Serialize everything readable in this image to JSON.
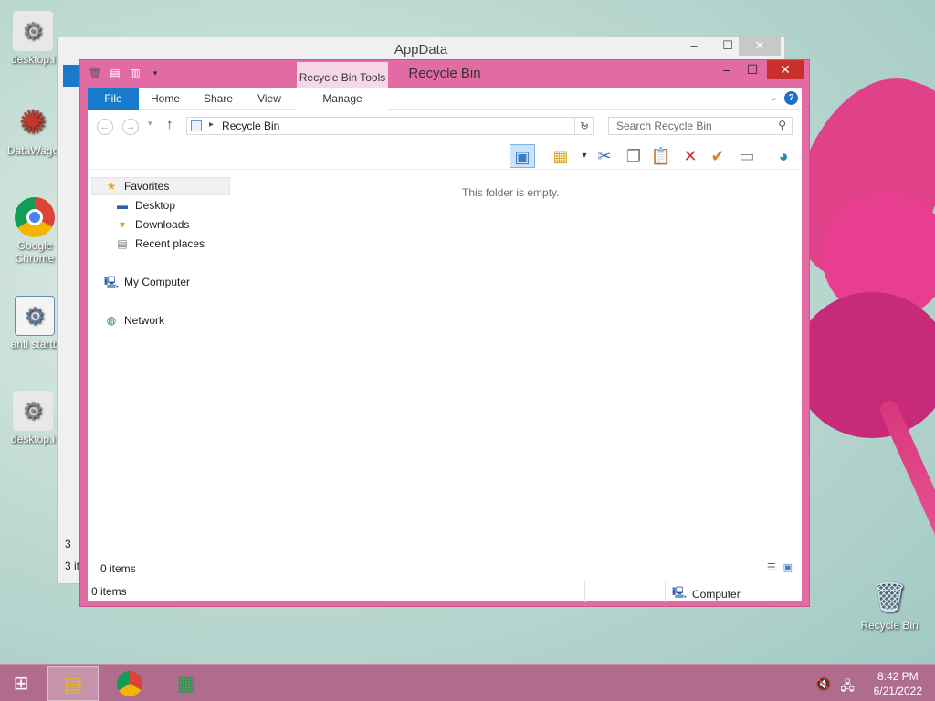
{
  "desktop": {
    "icons": [
      {
        "label": "desktop.i",
        "glyph": "⚙"
      },
      {
        "label": "DataWago",
        "glyph": "✺"
      },
      {
        "label": "Google Chrome",
        "glyph": "◉"
      },
      {
        "label": "anti startb",
        "glyph": "⚙"
      },
      {
        "label": "desktop.i",
        "glyph": "⚙"
      },
      {
        "label": "Recycle Bin",
        "glyph": "🗑"
      }
    ]
  },
  "background_window": {
    "title": "AppData",
    "status": "3 it",
    "side_number": "3"
  },
  "window": {
    "title": "Recycle Bin",
    "context_tab_group": "Recycle Bin Tools",
    "ribbon_tabs": [
      "File",
      "Home",
      "Share",
      "View",
      "Manage"
    ],
    "address": {
      "breadcrumb": "Recycle Bin",
      "search_placeholder": "Search Recycle Bin"
    },
    "nav": {
      "favorites": "Favorites",
      "desktop": "Desktop",
      "downloads": "Downloads",
      "recent": "Recent places",
      "computer": "My Computer",
      "network": "Network"
    },
    "content": {
      "empty_message": "This folder is empty.",
      "items_count": "0 items"
    },
    "status": {
      "items": "0 items",
      "location": "Computer"
    }
  },
  "taskbar": {
    "time": "8:42 PM",
    "date": "6/21/2022"
  },
  "colors": {
    "window_frame": "#e26ba4",
    "file_tab": "#1979ca",
    "taskbar": "#b06c8d",
    "close": "#c9302c"
  }
}
